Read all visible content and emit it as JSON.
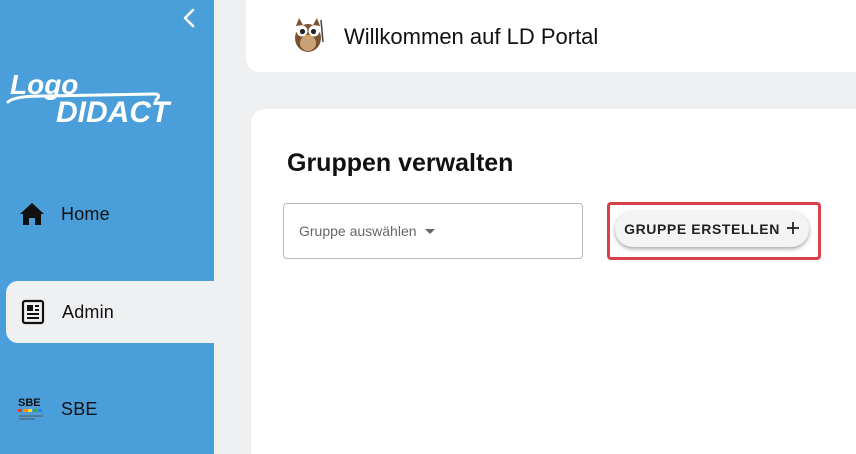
{
  "sidebar": {
    "logo_text_top": "Logo",
    "logo_text_bottom": "DIDACT",
    "items": [
      {
        "label": "Home",
        "icon": "home-icon"
      },
      {
        "label": "Admin",
        "icon": "newspaper-icon",
        "active": true
      },
      {
        "label": "SBE",
        "icon": "sbe-logo-icon"
      }
    ],
    "sbe_badge": "SBE"
  },
  "header": {
    "title": "Willkommen auf LD Portal",
    "mascot": "owl-icon"
  },
  "main": {
    "title": "Gruppen verwalten",
    "group_select": {
      "placeholder": "Gruppe auswählen"
    },
    "create_button": {
      "label": "GRUPPE ERSTELLEN",
      "icon": "plus-icon"
    }
  },
  "colors": {
    "sidebar": "#4a9ed9",
    "background": "#eff0f2",
    "highlight": "#d9414a"
  }
}
